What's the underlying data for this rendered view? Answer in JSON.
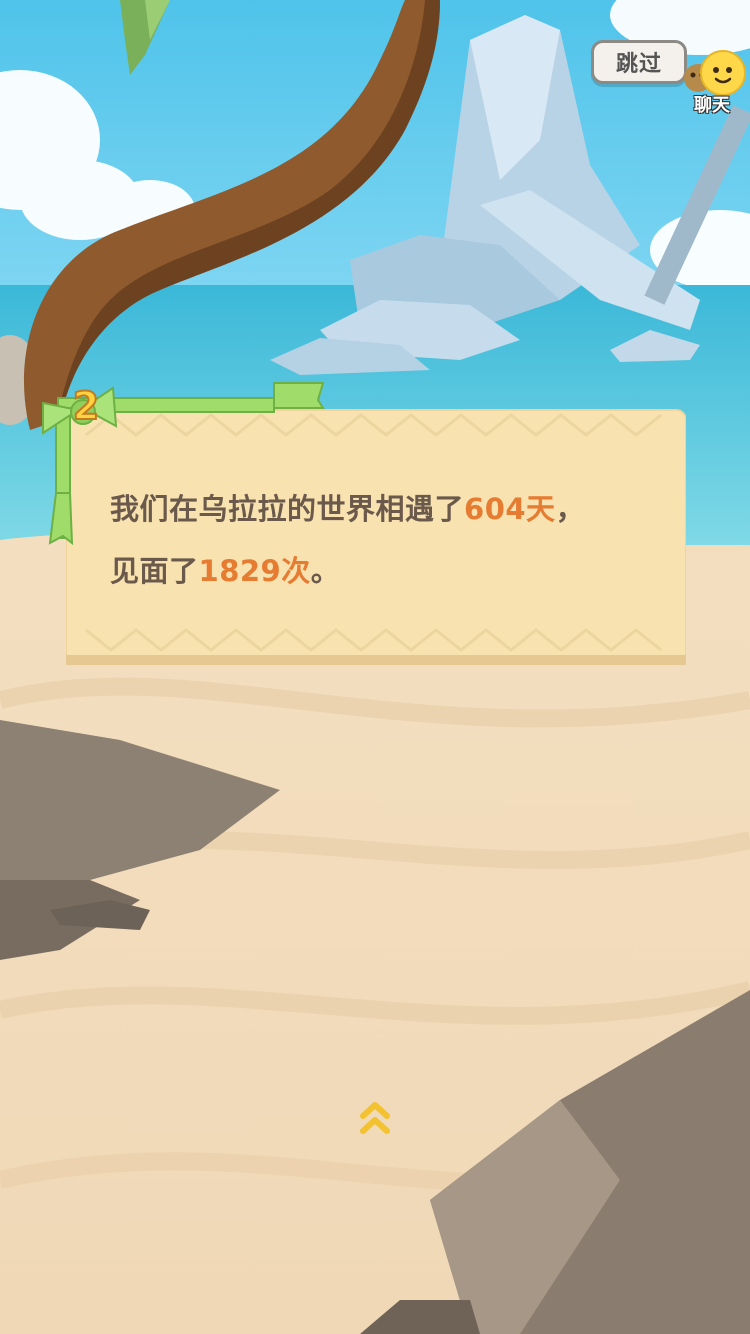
{
  "top_bar": {
    "skip_label": "跳过",
    "chat_label": "聊天"
  },
  "badge": {
    "number": "2"
  },
  "card": {
    "line1_prefix": "我们在乌拉拉的世界相遇了",
    "days": "604天",
    "line1_suffix": "，",
    "line2_prefix": "见面了",
    "times": "1829次",
    "line2_suffix": "。"
  },
  "colors": {
    "highlight": "#e67b32",
    "text": "#6b5a4c",
    "card_bg": "#f7e2b0",
    "ribbon_green": "#9fdc6a"
  },
  "icons": {
    "chat": "chick-emoji-icon",
    "scroll": "double-chevron-up-icon"
  }
}
